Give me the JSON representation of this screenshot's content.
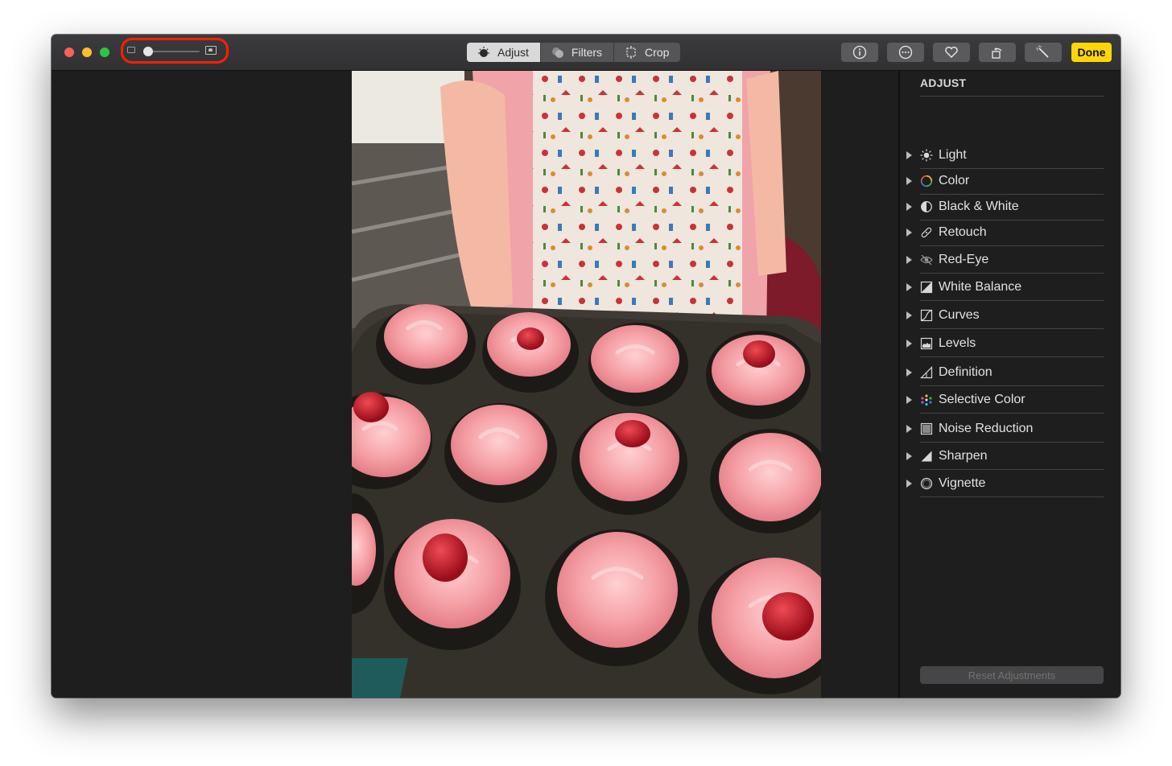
{
  "toolbar": {
    "adjust_label": "Adjust",
    "filters_label": "Filters",
    "crop_label": "Crop",
    "done_label": "Done",
    "icons": [
      "info-icon",
      "more-icon",
      "heart-icon",
      "rotate-icon",
      "magic-wand-icon"
    ]
  },
  "sidebar": {
    "title": "ADJUST",
    "items": [
      {
        "label": "Light",
        "icon": "sun-icon"
      },
      {
        "label": "Color",
        "icon": "color-ring-icon"
      },
      {
        "label": "Black & White",
        "icon": "half-circle-icon"
      },
      {
        "label": "Retouch",
        "icon": "bandage-icon"
      },
      {
        "label": "Red-Eye",
        "icon": "eye-icon"
      },
      {
        "label": "White Balance",
        "icon": "white-balance-icon"
      },
      {
        "label": "Curves",
        "icon": "curves-icon"
      },
      {
        "label": "Levels",
        "icon": "levels-icon"
      },
      {
        "label": "Definition",
        "icon": "definition-icon"
      },
      {
        "label": "Selective Color",
        "icon": "selective-color-icon"
      },
      {
        "label": "Noise Reduction",
        "icon": "noise-icon"
      },
      {
        "label": "Sharpen",
        "icon": "sharpen-icon"
      },
      {
        "label": "Vignette",
        "icon": "vignette-icon"
      }
    ],
    "reset_label": "Reset Adjustments"
  },
  "colors": {
    "done": "#ffd60a",
    "highlight": "#ff1e00",
    "close": "#fe5f57",
    "minimize": "#febc2e",
    "maximize": "#28c840"
  },
  "zoom_level": 0
}
